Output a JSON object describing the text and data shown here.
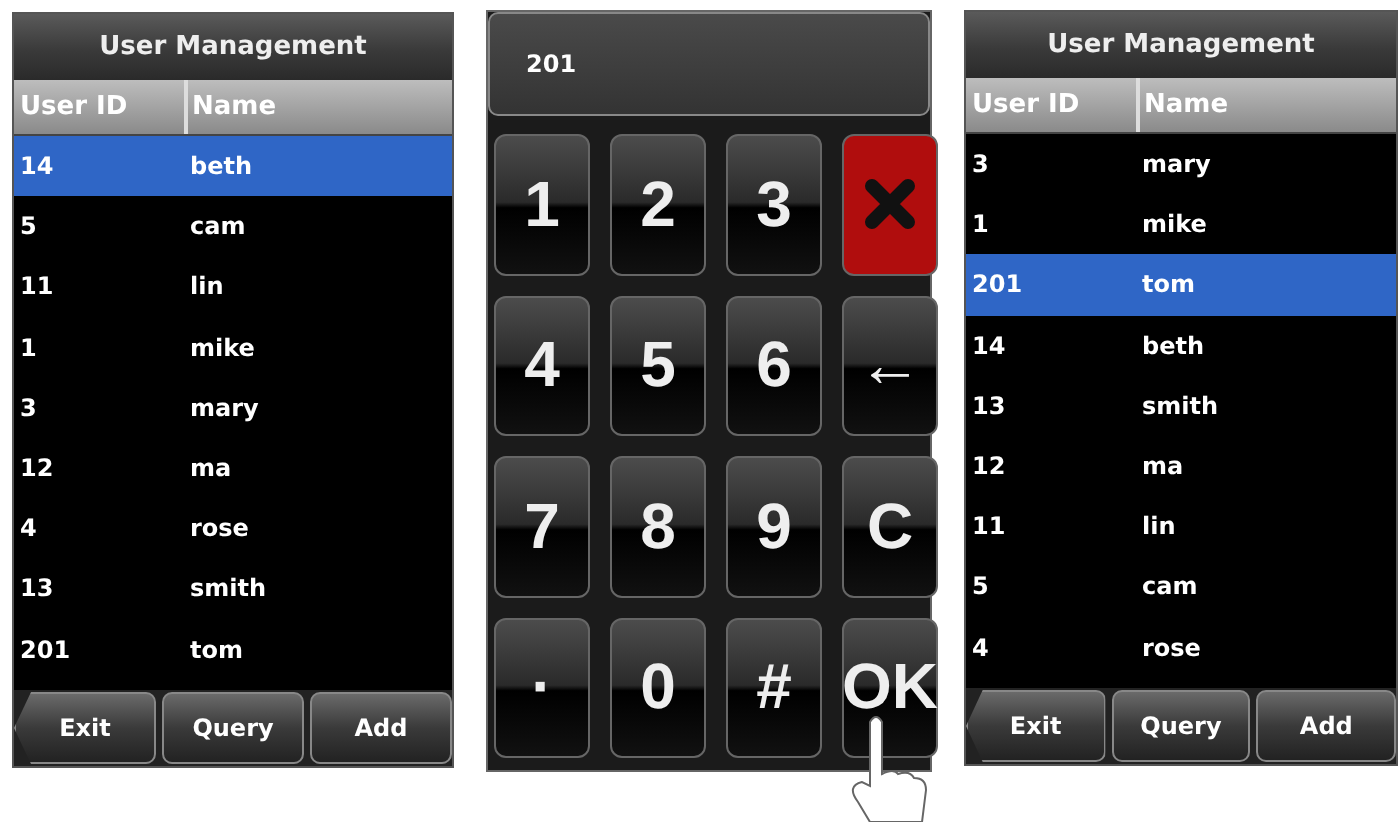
{
  "screens": [
    {
      "kind": "list",
      "title": "User Management",
      "columns": [
        "User ID",
        "Name"
      ],
      "rows": [
        {
          "user_id": "14",
          "name": "beth",
          "selected": true
        },
        {
          "user_id": "5",
          "name": "cam",
          "selected": false
        },
        {
          "user_id": "11",
          "name": "lin",
          "selected": false
        },
        {
          "user_id": "1",
          "name": "mike",
          "selected": false
        },
        {
          "user_id": "3",
          "name": "mary",
          "selected": false
        },
        {
          "user_id": "12",
          "name": "ma",
          "selected": false
        },
        {
          "user_id": "4",
          "name": "rose",
          "selected": false
        },
        {
          "user_id": "13",
          "name": "smith",
          "selected": false
        },
        {
          "user_id": "201",
          "name": "tom",
          "selected": false
        }
      ],
      "buttons": [
        "Exit",
        "Query",
        "Add"
      ]
    },
    {
      "kind": "keypad",
      "input": "201",
      "keys": [
        {
          "kind": "text",
          "label": "1"
        },
        {
          "kind": "text",
          "label": "2"
        },
        {
          "kind": "text",
          "label": "3"
        },
        {
          "kind": "cancel"
        },
        {
          "kind": "text",
          "label": "4"
        },
        {
          "kind": "text",
          "label": "5"
        },
        {
          "kind": "text",
          "label": "6"
        },
        {
          "kind": "text",
          "label": "←"
        },
        {
          "kind": "text",
          "label": "7"
        },
        {
          "kind": "text",
          "label": "8"
        },
        {
          "kind": "text",
          "label": "9"
        },
        {
          "kind": "text",
          "label": "C"
        },
        {
          "kind": "text",
          "label": "·"
        },
        {
          "kind": "text",
          "label": "0"
        },
        {
          "kind": "text",
          "label": "#"
        },
        {
          "kind": "text",
          "label": "OK"
        }
      ]
    },
    {
      "kind": "list",
      "title": "User Management",
      "columns": [
        "User ID",
        "Name"
      ],
      "rows": [
        {
          "user_id": "3",
          "name": "mary",
          "selected": false
        },
        {
          "user_id": "1",
          "name": "mike",
          "selected": false
        },
        {
          "user_id": "201",
          "name": "tom",
          "selected": true
        },
        {
          "user_id": "14",
          "name": "beth",
          "selected": false
        },
        {
          "user_id": "13",
          "name": "smith",
          "selected": false
        },
        {
          "user_id": "12",
          "name": "ma",
          "selected": false
        },
        {
          "user_id": "11",
          "name": "lin",
          "selected": false
        },
        {
          "user_id": "5",
          "name": "cam",
          "selected": false
        },
        {
          "user_id": "4",
          "name": "rose",
          "selected": false
        }
      ],
      "buttons": [
        "Exit",
        "Query",
        "Add"
      ]
    }
  ]
}
